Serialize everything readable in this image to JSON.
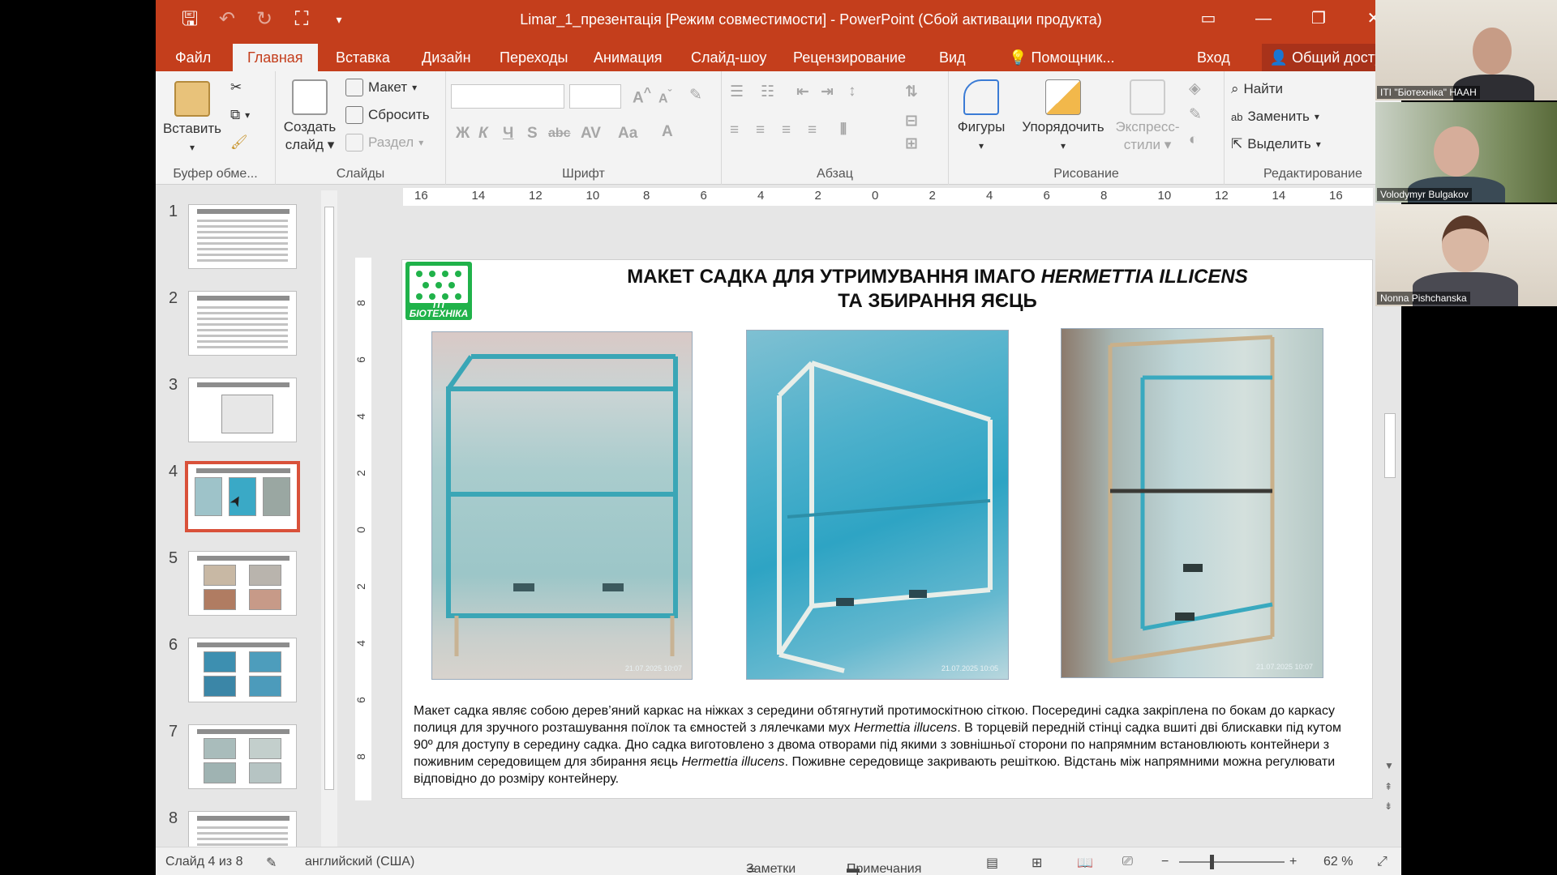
{
  "window": {
    "title": "Limar_1_презентація [Режим совместимости] - PowerPoint (Сбой активации продукта)"
  },
  "tabs": [
    "Файл",
    "Главная",
    "Вставка",
    "Дизайн",
    "Переходы",
    "Анимация",
    "Слайд-шоу",
    "Рецензирование",
    "Вид",
    "Помощник..."
  ],
  "account": {
    "signin": "Вход",
    "share": "Общий доступ"
  },
  "ribbon": {
    "clipboard": {
      "paste": "Вставить",
      "label": "Буфер обме..."
    },
    "slides": {
      "new_slide": "Создать слайд",
      "layout": "Макет",
      "reset": "Сбросить",
      "section": "Раздел",
      "label": "Слайды"
    },
    "font": {
      "label": "Шрифт"
    },
    "paragraph": {
      "label": "Абзац"
    },
    "drawing": {
      "shapes": "Фигуры",
      "arrange": "Упорядочить",
      "quick_styles": "Экспресс-стили",
      "label": "Рисование"
    },
    "editing": {
      "find": "Найти",
      "replace": "Заменить",
      "select": "Выделить",
      "label": "Редактирование"
    }
  },
  "ruler": {
    "horizontal": [
      "16",
      "14",
      "12",
      "10",
      "8",
      "6",
      "4",
      "2",
      "0",
      "2",
      "4",
      "6",
      "8",
      "10",
      "12",
      "14",
      "16"
    ],
    "vertical": [
      "8",
      "6",
      "4",
      "2",
      "0",
      "2",
      "4",
      "6",
      "8"
    ]
  },
  "thumbnails": [
    "1",
    "2",
    "3",
    "4",
    "5",
    "6",
    "7",
    "8"
  ],
  "selected_slide": 4,
  "slide": {
    "logo_text": "ІТІ БІОТЕХНІКА",
    "title_line1_plain": "МАКЕТ САДКА ДЛЯ УТРИМУВАННЯ ІМАГО ",
    "title_line1_italic": "HERMETTIA ILLICENS",
    "title_line2": "ТА ЗБИРАННЯ ЯЄЦЬ",
    "photo_stamps": [
      "21.07.2025 10:07",
      "21.07.2025 10:05",
      "21.07.2025 10:07"
    ],
    "body": [
      {
        "t": "Макет садка являє собою дерев’яний каркас на ніжках з середини обтягнутий протимоскітною сіткою. Посередині садка закріплена по бокам до каркасу полиця для зручного розташування поїлок та ємностей з лялечками мух "
      },
      {
        "i": "Hermettia illucens"
      },
      {
        "t": ". В торцевій передній стінці садка вшиті дві блискавки під кутом 90º для доступу в середину садка. Дно садка виготовлено з двома отворами під якими з зовнішньої сторони по напрямним встановлюють контейнери з поживним середовищем для збирання яєць "
      },
      {
        "i": "Hermettia illucens"
      },
      {
        "t": ". Поживне середовище закривають решіткою. Відстань між напрямними можна регулювати відповідно до розміру контейнеру."
      }
    ]
  },
  "status": {
    "slide_of": "Слайд 4 из 8",
    "language": "английский (США)",
    "notes": "Заметки",
    "comments": "Примечания",
    "zoom": "62 %"
  },
  "participants": [
    "ІТІ \"Біотехніка\" НААН",
    "Volodymyr Bulgakov",
    "Nonna Pishchanska"
  ],
  "colors": {
    "accent": "#c43e1c",
    "selection": "#d9513a",
    "logo_green": "#20b24a"
  }
}
